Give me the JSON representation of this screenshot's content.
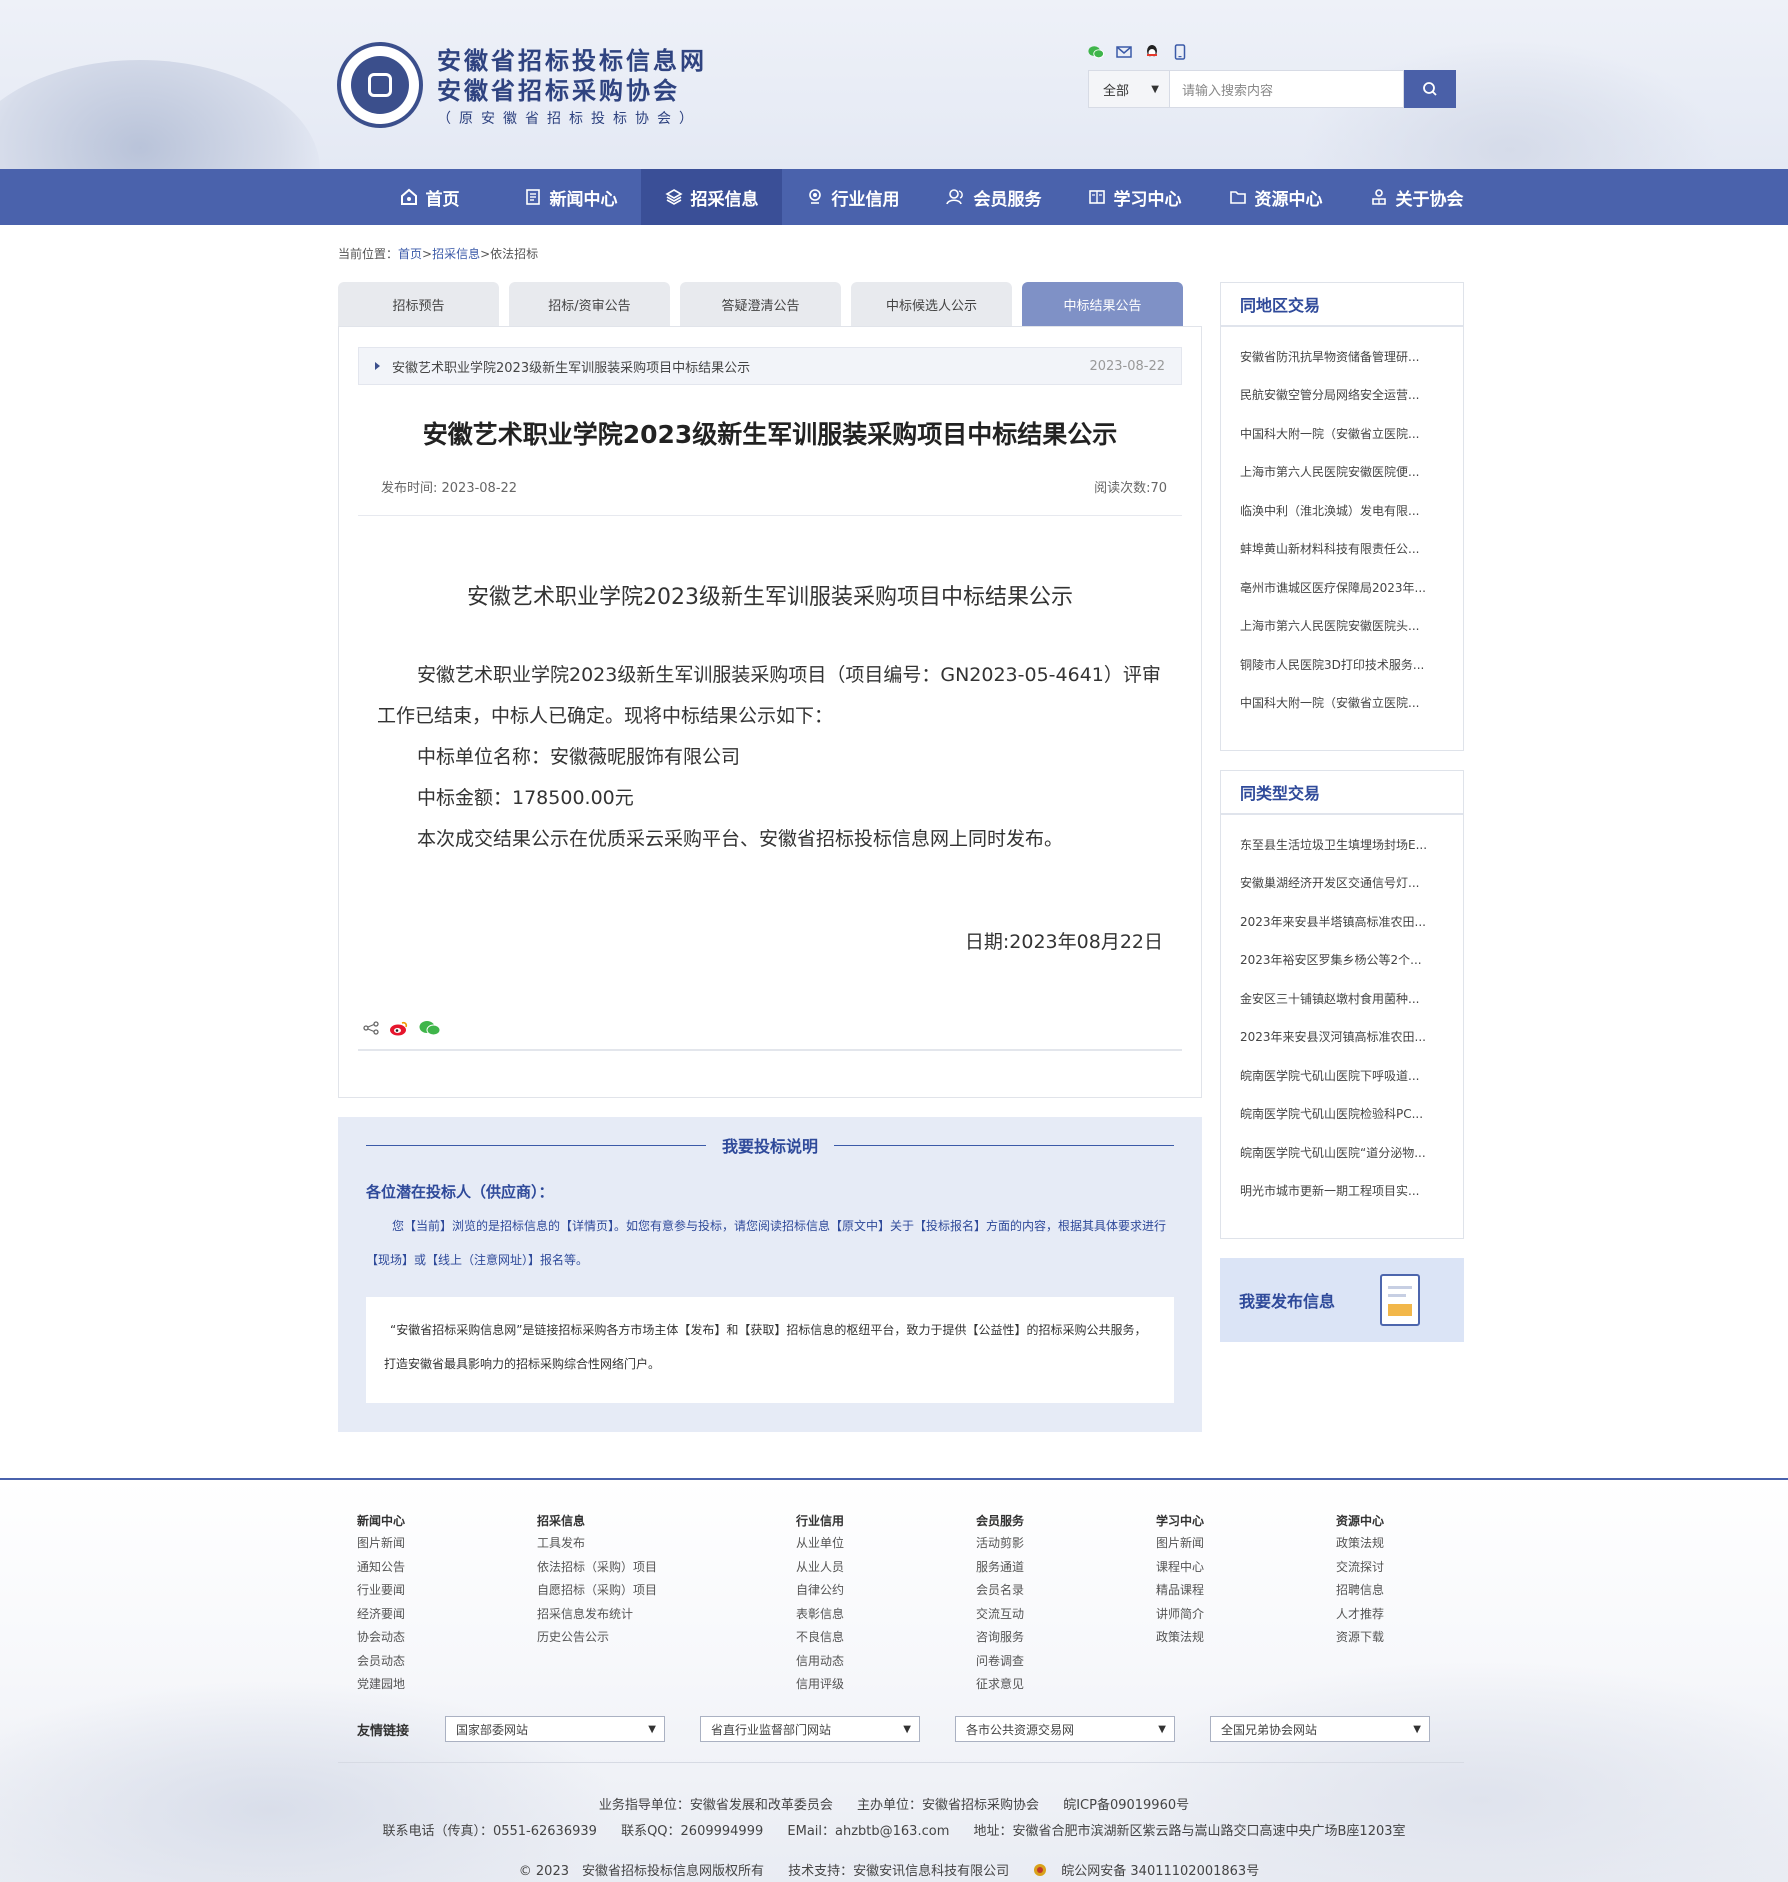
{
  "header": {
    "brand_line1": "安徽省招标投标信息网",
    "brand_line2": "安徽省招标采购协会",
    "brand_line3": "（原安徽省招标投标协会）",
    "search": {
      "scope_value": "全部",
      "placeholder": "请输入搜索内容"
    },
    "icons": [
      "wechat-icon",
      "mail-icon",
      "qq-icon",
      "mobile-icon"
    ]
  },
  "nav": {
    "items": [
      {
        "label": "首页",
        "icon": "home-icon"
      },
      {
        "label": "新闻中心",
        "icon": "news-icon"
      },
      {
        "label": "招采信息",
        "icon": "layers-icon",
        "active": true
      },
      {
        "label": "行业信用",
        "icon": "location-icon"
      },
      {
        "label": "会员服务",
        "icon": "users-icon"
      },
      {
        "label": "学习中心",
        "icon": "book-icon"
      },
      {
        "label": "资源中心",
        "icon": "folder-icon"
      },
      {
        "label": "关于协会",
        "icon": "person-icon"
      }
    ]
  },
  "breadcrumb": {
    "prefix": "当前位置：",
    "home": "首页",
    "sep1": ">",
    "level1": "招采信息",
    "sep2": ">",
    "current": "依法招标"
  },
  "tabs": [
    {
      "label": "招标预告"
    },
    {
      "label": "招标/资审公告"
    },
    {
      "label": "答疑澄清公告"
    },
    {
      "label": "中标候选人公示"
    },
    {
      "label": "中标结果公告",
      "active": true
    }
  ],
  "article": {
    "notice_title": "安徽艺术职业学院2023级新生军训服装采购项目中标结果公示",
    "notice_date": "2023-08-22",
    "title": "安徽艺术职业学院2023级新生军训服装采购项目中标结果公示",
    "publish_time": "发布时间: 2023-08-22",
    "read_count": "阅读次数:70",
    "subtitle": "安徽艺术职业学院2023级新生军训服装采购项目中标结果公示",
    "para1": "安徽艺术职业学院2023级新生军训服装采购项目（项目编号：GN2023-05-4641）评审工作已结束，中标人已确定。现将中标结果公示如下：",
    "winner": "中标单位名称：安徽薇昵服饰有限公司",
    "amount": "中标金额：178500.00元",
    "release": "本次成交结果公示在优质采云采购平台、安徽省招标投标信息网上同时发布。",
    "date": "日期:2023年08月22日"
  },
  "bid_info": {
    "title": "我要投标说明",
    "to": "各位潜在投标人（供应商）：",
    "para": "您【当前】浏览的是招标信息的【详情页】。如您有意参与投标，请您阅读招标信息【原文中】关于【投标报名】方面的内容，根据其具体要求进行【现场】或【线上（注意网址）】报名等。",
    "box": "“安徽省招标采购信息网”是链接招标采购各方市场主体【发布】和【获取】招标信息的枢纽平台，致力于提供【公益性】的招标采购公共服务，打造安徽省最具影响力的招标采购综合性网络门户。"
  },
  "sidebar": {
    "same_region": {
      "title": "同地区交易",
      "items": [
        "安徽省防汛抗旱物资储备管理研...",
        "民航安徽空管分局网络安全运营...",
        "中国科大附一院（安徽省立医院...",
        "上海市第六人民医院安徽医院便...",
        "临涣中利（淮北涣城）发电有限...",
        "蚌埠黄山新材料科技有限责任公...",
        "亳州市谯城区医疗保障局2023年...",
        "上海市第六人民医院安徽医院头...",
        "铜陵市人民医院3D打印技术服务...",
        "中国科大附一院（安徽省立医院..."
      ]
    },
    "same_type": {
      "title": "同类型交易",
      "items": [
        "东至县生活垃圾卫生填埋场封场E...",
        "安徽巢湖经济开发区交通信号灯...",
        "2023年来安县半塔镇高标准农田...",
        "2023年裕安区罗集乡杨公等2个...",
        "金安区三十铺镇赵墩村食用菌种...",
        "2023年来安县汊河镇高标准农田...",
        "皖南医学院弋矶山医院下呼吸道...",
        "皖南医学院弋矶山医院检验科PC...",
        "皖南医学院弋矶山医院“道分泌物...",
        "明光市城市更新一期工程项目实..."
      ]
    },
    "publish_label": "我要发布信息"
  },
  "footer": {
    "columns": [
      {
        "title": "新闻中心",
        "items": [
          "图片新闻",
          "通知公告",
          "行业要闻",
          "经济要闻",
          "协会动态",
          "会员动态",
          "党建园地"
        ]
      },
      {
        "title": "招采信息",
        "items": [
          "工具发布",
          "依法招标（采购）项目",
          "自愿招标（采购）项目",
          "招采信息发布统计",
          "历史公告公示"
        ]
      },
      {
        "title": "行业信用",
        "items": [
          "从业单位",
          "从业人员",
          "自律公约",
          "表彰信息",
          "不良信息",
          "信用动态",
          "信用评级"
        ]
      },
      {
        "title": "会员服务",
        "items": [
          "活动剪影",
          "服务通道",
          "会员名录",
          "交流互动",
          "咨询服务",
          "问卷调查",
          "征求意见"
        ]
      },
      {
        "title": "学习中心",
        "items": [
          "图片新闻",
          "课程中心",
          "精品课程",
          "讲师简介",
          "政策法规"
        ]
      },
      {
        "title": "资源中心",
        "items": [
          "政策法规",
          "交流探讨",
          "招聘信息",
          "人才推荐",
          "资源下载"
        ]
      }
    ],
    "links_label": "友情链接",
    "link_selects": [
      "国家部委网站",
      "省直行业监督部门网站",
      "各市公共资源交易网",
      "全国兄弟协会网站"
    ],
    "guide_unit": "业务指导单位：安徽省发展和改革委员会",
    "host_unit": "主办单位：安徽省招标采购协会",
    "icp": "皖ICP备09019960号",
    "phone": "联系电话（传真）：0551-62636939",
    "qq": "联系QQ：2609994999",
    "email": "EMail：ahzbtb@163.com",
    "address": "地址：安徽省合肥市滨湖新区紫云路与嵩山路交口高速中央广场B座1203室",
    "copyright": "© 2023　安徽省招标投标信息网版权所有",
    "tech_support": "技术支持：安徽安讯信息科技有限公司",
    "police": "皖公网安备 34011102001863号"
  }
}
